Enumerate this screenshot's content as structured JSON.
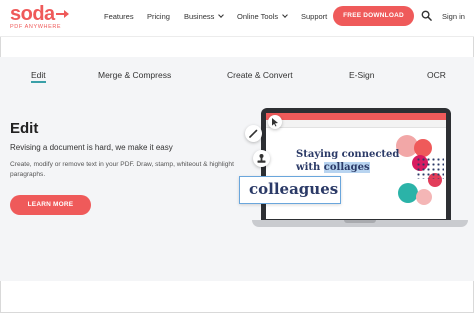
{
  "brand": {
    "name": "soda",
    "tagline": "PDF ANYWHERE",
    "accent": "#ef5a5a",
    "tab_accent": "#3aa0a8"
  },
  "nav": {
    "items": [
      {
        "label": "Features",
        "has_menu": false
      },
      {
        "label": "Pricing",
        "has_menu": false
      },
      {
        "label": "Business",
        "has_menu": true
      },
      {
        "label": "Online Tools",
        "has_menu": true
      },
      {
        "label": "Support",
        "has_menu": false
      }
    ],
    "cta": "FREE DOWNLOAD",
    "search_icon": "search-icon",
    "signin": "Sign in"
  },
  "tabs": {
    "items": [
      {
        "label": "Edit",
        "active": true
      },
      {
        "label": "Merge & Compress",
        "active": false
      },
      {
        "label": "Create & Convert",
        "active": false
      },
      {
        "label": "E-Sign",
        "active": false
      },
      {
        "label": "OCR",
        "active": false
      }
    ]
  },
  "hero": {
    "title": "Edit",
    "subtitle": "Revising a document is hard, we make it easy",
    "description": "Create, modify or remove text in your PDF. Draw, stamp, whiteout & highlight paragraphs.",
    "button": "LEARN MORE"
  },
  "illustration": {
    "doc_line1": "Staying connected",
    "doc_line2_prefix": "with ",
    "doc_line2_highlight": "collages",
    "zoom_text": "colleagues",
    "tool_icons": [
      "pen-icon",
      "stamp-icon",
      "cursor-icon"
    ]
  }
}
